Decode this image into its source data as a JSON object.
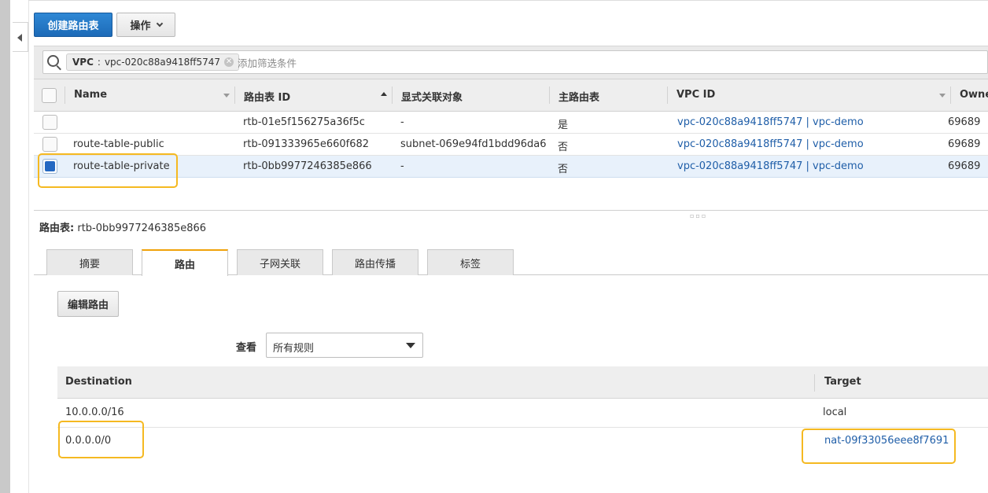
{
  "toolbar": {
    "create_label": "创建路由表",
    "actions_label": "操作"
  },
  "filter": {
    "token_key": "VPC",
    "token_sep": ":",
    "token_value": "vpc-020c88a9418ff5747",
    "placeholder": "添加筛选条件"
  },
  "table": {
    "columns": [
      "Name",
      "路由表 ID",
      "显式关联对象",
      "主路由表",
      "VPC ID",
      "Owne"
    ],
    "rows": [
      {
        "name": "",
        "id": "rtb-01e5f156275a36f5c",
        "assoc": "-",
        "main": "是",
        "vpc": "vpc-020c88a9418ff5747 | vpc-demo",
        "owner": "69689",
        "selected": false
      },
      {
        "name": "route-table-public",
        "id": "rtb-091333965e660f682",
        "assoc": "subnet-069e94fd1bdd96da6",
        "main": "否",
        "vpc": "vpc-020c88a9418ff5747 | vpc-demo",
        "owner": "69689",
        "selected": false
      },
      {
        "name": "route-table-private",
        "id": "rtb-0bb9977246385e866",
        "assoc": "-",
        "main": "否",
        "vpc": "vpc-020c88a9418ff5747 | vpc-demo",
        "owner": "69689",
        "selected": true
      }
    ]
  },
  "detail": {
    "label": "路由表:",
    "value": "rtb-0bb9977246385e866",
    "tabs": [
      "摘要",
      "路由",
      "子网关联",
      "路由传播",
      "标签"
    ],
    "active_tab": "路由",
    "edit_routes_label": "编辑路由",
    "view_label": "查看",
    "view_selected": "所有规则"
  },
  "routes": {
    "columns": [
      "Destination",
      "Target"
    ],
    "rows": [
      {
        "destination": "10.0.0.0/16",
        "target": "local",
        "target_is_link": false
      },
      {
        "destination": "0.0.0.0/0",
        "target": "nat-09f33056eee8f7691",
        "target_is_link": true
      }
    ]
  },
  "colors": {
    "primary_button": "#1f70c1",
    "link": "#1f5ea8",
    "highlight_box": "#f5b921",
    "selected_row": "#e8f1fb",
    "active_tab_accent": "#f0a20a"
  }
}
